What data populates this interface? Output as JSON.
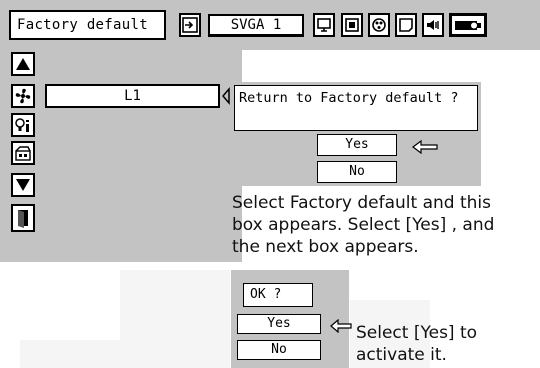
{
  "menu": {
    "title": "Factory default",
    "input_source": "SVGA 1",
    "toolbar_icons": [
      "input-icon",
      "screen-icon",
      "image-size-icon",
      "color-adjust-icon",
      "setting-icon",
      "sound-icon",
      "projector-icon"
    ]
  },
  "sidebar": {
    "icons": [
      "up-arrow-icon",
      "fan-icon",
      "info-icon",
      "factory-default-icon",
      "down-arrow-icon",
      "exit-door-icon"
    ],
    "level_value": "L1"
  },
  "confirm_dialog": {
    "question": "Return to Factory default ?",
    "yes_label": "Yes",
    "no_label": "No"
  },
  "ok_dialog": {
    "question": "OK ?",
    "yes_label": "Yes",
    "no_label": "No"
  },
  "descriptions": {
    "line1": "Select Factory default and this",
    "line2": "box appears.  Select [Yes] , and",
    "line3": "the next box appears.",
    "step2_line1": "Select [Yes] to",
    "step2_line2": "activate it."
  }
}
